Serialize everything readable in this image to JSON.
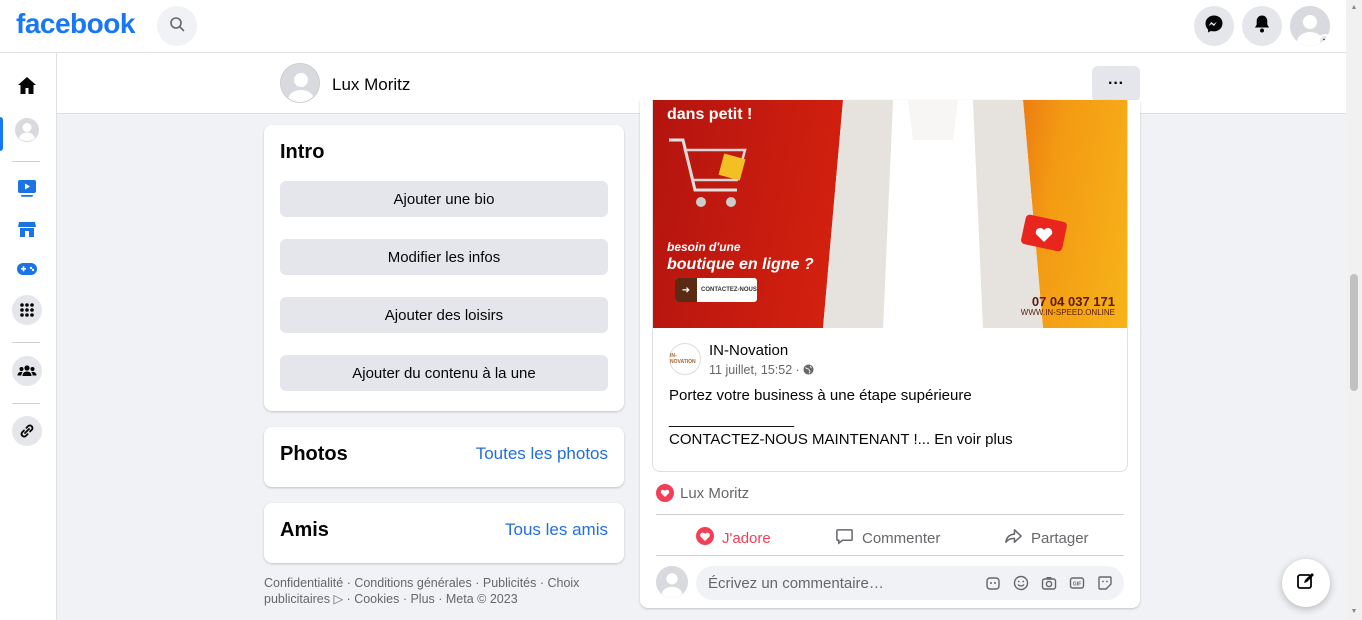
{
  "header": {
    "logo": "facebook",
    "icons": [
      "search-icon",
      "messenger-icon",
      "notifications-icon",
      "account-avatar"
    ]
  },
  "rail": {
    "items": [
      "home-icon",
      "profile-icon",
      "video-icon",
      "marketplace-icon",
      "gaming-icon",
      "menu-icon",
      "groups-icon",
      "link-icon"
    ]
  },
  "profile_header": {
    "name": "Lux Moritz",
    "more_label": "···"
  },
  "intro": {
    "title": "Intro",
    "buttons": [
      "Ajouter une bio",
      "Modifier les infos",
      "Ajouter des loisirs",
      "Ajouter du contenu à la une"
    ]
  },
  "photos": {
    "title": "Photos",
    "link": "Toutes les photos"
  },
  "friends": {
    "title": "Amis",
    "link": "Tous les amis"
  },
  "footer": {
    "line1": "Confidentialité · Conditions générales · Publicités · Choix",
    "line2": "publicitaires ▷ · Cookies · Plus · Meta © 2023"
  },
  "post": {
    "ad": {
      "headline": "dans petit !",
      "sub1": "besoin d'une",
      "sub2": "boutique en ligne ?",
      "cta": "CONTACTEZ-NOUS",
      "phone": "07 04 037 171",
      "website": "WWW.IN-SPEED.ONLINE"
    },
    "source": {
      "avatar_text": "IN-NOVATION",
      "name": "IN-Novation",
      "time": "11 juillet, 15:52 ·",
      "body_line1": "Portez votre business à une étape supérieure",
      "body_line2": "_______________",
      "body_line3": "CONTACTEZ-NOUS MAINTENANT !...",
      "see_more": "En voir plus"
    },
    "reactions": {
      "reactor": "Lux Moritz"
    },
    "actions": {
      "love": "J'adore",
      "comment": "Commenter",
      "share": "Partager"
    },
    "comment_box": {
      "placeholder": "Écrivez un commentaire…"
    }
  },
  "colors": {
    "brand": "#1877f2",
    "love": "#f33e58",
    "link": "#216fdb"
  }
}
